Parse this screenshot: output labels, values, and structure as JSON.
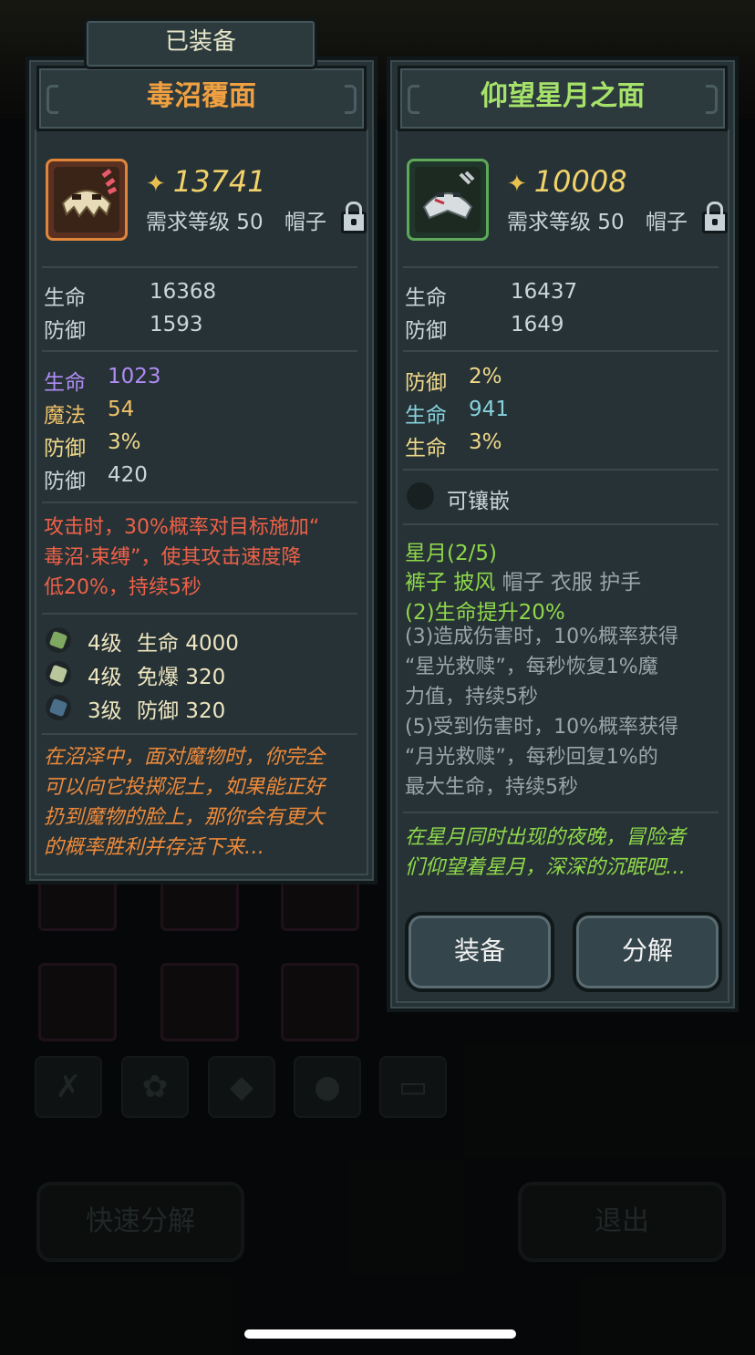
{
  "equipped_tag": "已装备",
  "left": {
    "name": "毒沼覆面",
    "name_color": "#f0a040",
    "power": "13741",
    "req_level": "需求等级 50",
    "slot": "帽子",
    "base_stats": [
      {
        "k": "生命",
        "v": "16368"
      },
      {
        "k": "防御",
        "v": "1593"
      }
    ],
    "extra_stats": [
      {
        "k": "生命",
        "v": "1023",
        "color": "#b08cf5"
      },
      {
        "k": "魔法",
        "v": "54",
        "color": "#efc068"
      },
      {
        "k": "防御",
        "v": "3%",
        "color": "#efd88a"
      },
      {
        "k": "防御",
        "v": "420",
        "color": "#c9d6da"
      }
    ],
    "effect": "攻击时，30%概率对目标施加“\n毒沼·束缚”，使其攻击速度降\n低20%，持续5秒",
    "gems": [
      {
        "level": "4级",
        "stat": "生命 4000",
        "color": "#7fa860"
      },
      {
        "level": "4级",
        "stat": "免爆 320",
        "color": "#b9c59a"
      },
      {
        "level": "3级",
        "stat": "防御 320",
        "color": "#4a6f8a"
      }
    ],
    "lore": "在沼泽中，面对魔物时，你完全\n可以向它投掷泥土，如果能正好\n扔到魔物的脸上，那你会有更大\n的概率胜利并存活下来…"
  },
  "right": {
    "name": "仰望星月之面",
    "name_color": "#a6e26a",
    "power": "10008",
    "req_level": "需求等级 50",
    "slot": "帽子",
    "base_stats": [
      {
        "k": "生命",
        "v": "16437"
      },
      {
        "k": "防御",
        "v": "1649"
      }
    ],
    "extra_stats": [
      {
        "k": "防御",
        "v": "2%",
        "color": "#efd88a"
      },
      {
        "k": "生命",
        "v": "941",
        "color": "#86d3dc"
      },
      {
        "k": "生命",
        "v": "3%",
        "color": "#efd88a"
      }
    ],
    "socket_label": "可镶嵌",
    "set_title": "星月(2/5)",
    "set_pieces_active": "裤子 披风",
    "set_pieces_inactive": "帽子 衣服 护手",
    "set_bonus_2": "(2)生命提升20%",
    "set_bonus_3": "(3)造成伤害时，10%概率获得\n“星光救赎”，每秒恢复1%魔\n力值，持续5秒",
    "set_bonus_5": "(5)受到伤害时，10%概率获得\n“月光救赎”，每秒回复1%的\n最大生命，持续5秒",
    "lore": "在星月同时出现的夜晚，冒险者\n们仰望着星月，深深的沉眠吧…",
    "equip_button": "装备",
    "dismantle_button": "分解"
  },
  "background": {
    "quick_dismantle": "快速分解",
    "exit": "退出"
  },
  "colors": {
    "panel_bg": "#263236",
    "text_light": "#c9d6da",
    "effect_red": "#ee6148",
    "lore_orange": "#ee8a3a",
    "lore_green": "#8fd84a",
    "set_green": "#8fd84a",
    "set_gray": "#9aa6aa"
  }
}
